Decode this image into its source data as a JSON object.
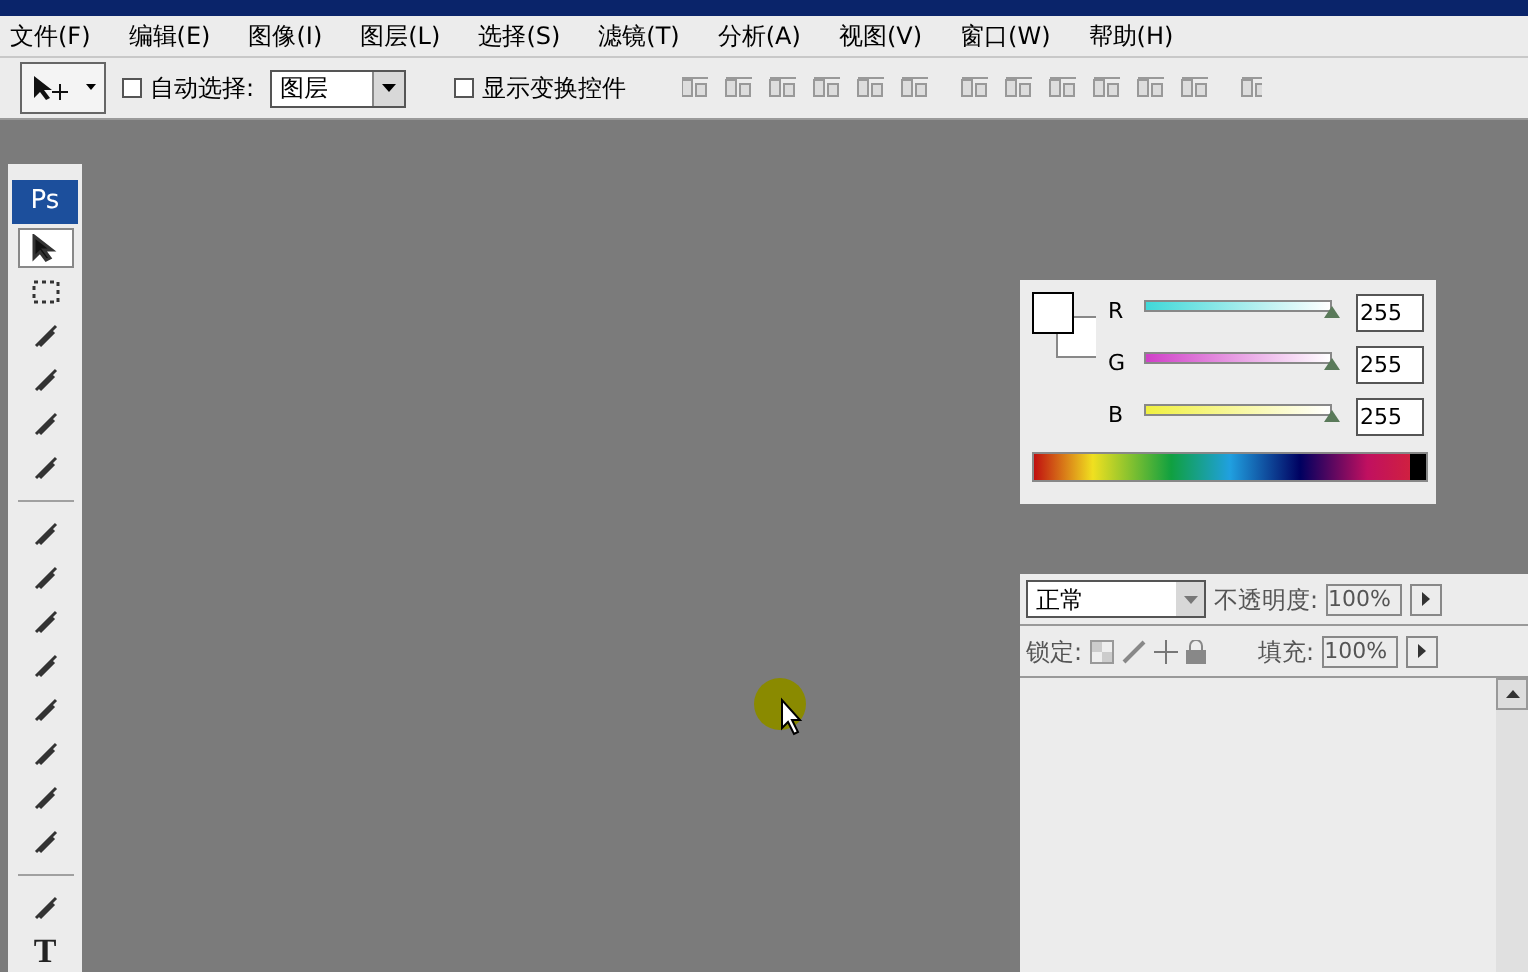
{
  "menu": [
    {
      "label": "文件(F)"
    },
    {
      "label": "编辑(E)"
    },
    {
      "label": "图像(I)"
    },
    {
      "label": "图层(L)"
    },
    {
      "label": "选择(S)"
    },
    {
      "label": "滤镜(T)"
    },
    {
      "label": "分析(A)"
    },
    {
      "label": "视图(V)"
    },
    {
      "label": "窗口(W)"
    },
    {
      "label": "帮助(H)"
    }
  ],
  "options_bar": {
    "auto_select": {
      "label": "自动选择:",
      "checked": false,
      "value": "图层"
    },
    "show_transform": {
      "label": "显示变换控件",
      "checked": false
    }
  },
  "toolbox": {
    "logo": "Ps",
    "tools": [
      {
        "kind": "move",
        "selected": true
      },
      {
        "kind": "marquee",
        "selected": false
      },
      {
        "kind": "lasso",
        "selected": false
      },
      {
        "kind": "wand",
        "selected": false
      },
      {
        "kind": "crop",
        "selected": false
      },
      {
        "kind": "slice",
        "selected": false
      },
      {
        "kind": "sep"
      },
      {
        "kind": "heal",
        "selected": false
      },
      {
        "kind": "brush",
        "selected": false
      },
      {
        "kind": "stamp",
        "selected": false
      },
      {
        "kind": "history",
        "selected": false
      },
      {
        "kind": "eraser",
        "selected": false
      },
      {
        "kind": "gradient",
        "selected": false
      },
      {
        "kind": "blur",
        "selected": false
      },
      {
        "kind": "dodge",
        "selected": false
      },
      {
        "kind": "sep"
      },
      {
        "kind": "pen",
        "selected": false
      },
      {
        "kind": "type",
        "selected": false,
        "label": "T"
      }
    ]
  },
  "color_panel": {
    "channels": [
      {
        "name": "R",
        "level": 1,
        "value": "255"
      },
      {
        "name": "G",
        "level": 1,
        "value": "255"
      },
      {
        "name": "B",
        "level": 1,
        "value": "255"
      }
    ]
  },
  "layers_panel": {
    "blend_mode": "正常",
    "opacity_label": "不透明度:",
    "opacity": "100%",
    "lock_label": "锁定:",
    "fill_label": "填充:",
    "fill": "100%"
  }
}
